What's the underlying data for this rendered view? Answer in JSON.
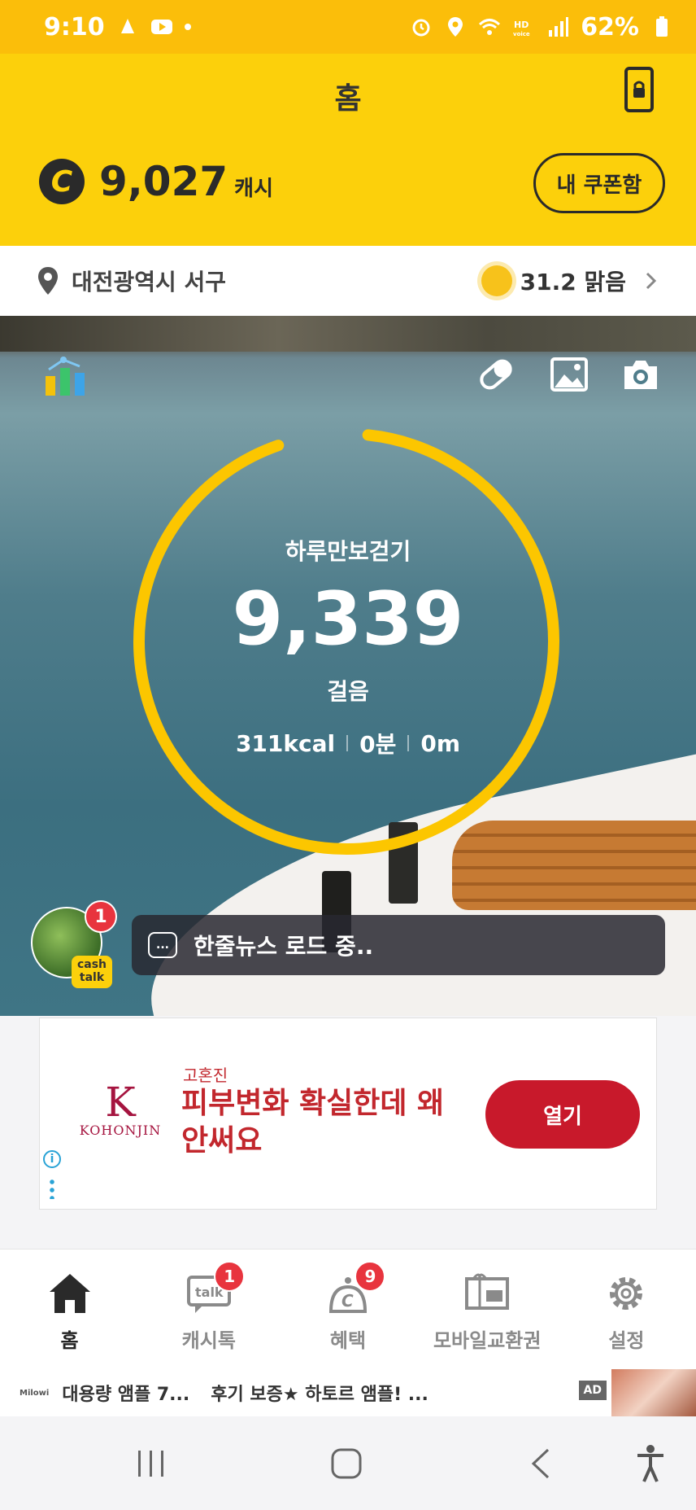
{
  "status_bar": {
    "time": "9:10",
    "battery": "62%"
  },
  "header": {
    "title": "홈",
    "cash_symbol": "C",
    "cash_value": "9,027",
    "cash_unit": "캐시",
    "coupon_button": "내 쿠폰함"
  },
  "location": {
    "place": "대전광역시 서구",
    "weather": "31.2 맑음"
  },
  "pedometer": {
    "title": "하루만보걷기",
    "steps": "9,339",
    "unit": "걸음",
    "calories": "311kcal",
    "minutes": "0분",
    "distance": "0m",
    "goal_progress": 0.93
  },
  "news": {
    "badge": "1",
    "tag": "cash talk",
    "text": "한줄뉴스 로드 중..",
    "dots": "..."
  },
  "ad": {
    "logo_mark": "K",
    "logo_name": "KOHONJIN",
    "brand": "고혼진",
    "headline": "피부변화 확실한데 왜 안써요",
    "button": "열기",
    "info": "i"
  },
  "bottom_nav": {
    "items": [
      {
        "label": "홈",
        "icon": "home-icon",
        "badge": ""
      },
      {
        "label": "캐시톡",
        "icon": "talk-icon",
        "badge": "1"
      },
      {
        "label": "혜택",
        "icon": "benefit-icon",
        "badge": "9"
      },
      {
        "label": "모바일교환권",
        "icon": "gift-voucher-icon",
        "badge": ""
      },
      {
        "label": "설정",
        "icon": "gear-icon",
        "badge": ""
      }
    ]
  },
  "banner": {
    "brand": "Milowi",
    "title": "대용량 앰플 7...",
    "text": "후기 보증★ 하토르 앰플! ...",
    "ad_label": "AD"
  },
  "colors": {
    "brand_yellow": "#fcd00b",
    "ring": "#fcc600",
    "ad_red": "#c8192b"
  }
}
